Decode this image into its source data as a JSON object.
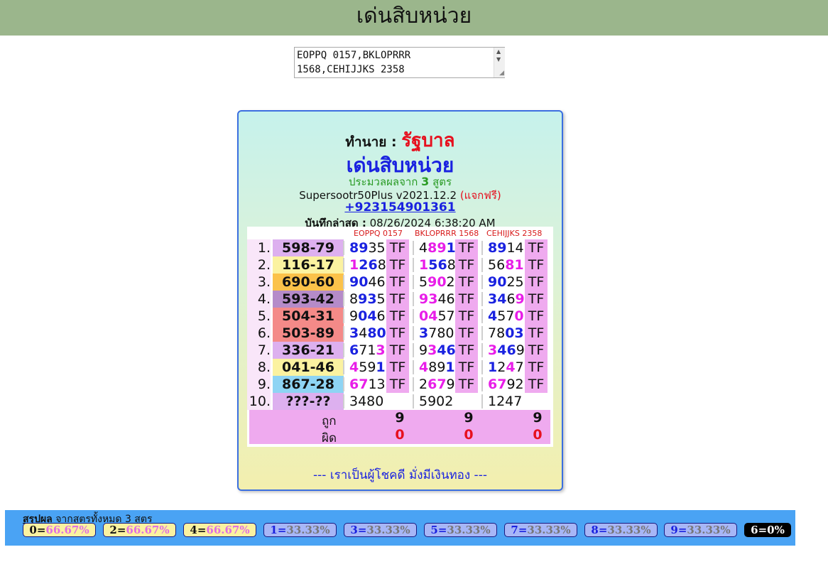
{
  "header": {
    "title": "เด่นสิบหน่วย"
  },
  "formula_input": {
    "value": "EOPPQ 0157,BKLOPRRR\n1568,CEHIJJKS 2358"
  },
  "card": {
    "by_label": "ทำนาย :",
    "by_value": "รัฐบาล",
    "title": "เด่นสิบหน่วย",
    "process_prefix": "ประมวลผลจาก",
    "process_count": "3",
    "process_suffix": "สูตร",
    "version": "Supersootr50Plus v2021.12.2",
    "free": "(แจกฟรี)",
    "phone": "+923154901361",
    "saved_label": "บันทึกล่าสุด :",
    "saved_value": "08/26/2024 6:38:20 AM",
    "motto": "--- เราเป็นผู้โชคดี มั่งมีเงินทอง ---"
  },
  "table": {
    "columns": [
      "EOPPQ 0157",
      "BKLOPRRR 1568",
      "CEHIJJKS 2358"
    ],
    "rows": [
      {
        "no": "1.",
        "pred": "598-79",
        "color": "#ddb0ef",
        "res": [
          [
            [
              "89",
              "b"
            ],
            [
              "35",
              "n"
            ]
          ],
          [
            [
              "4",
              "n"
            ],
            [
              "89",
              "m"
            ],
            [
              "1",
              "b"
            ]
          ],
          [
            [
              "89",
              "b"
            ],
            [
              "14",
              "n"
            ]
          ]
        ],
        "tf": [
          "TF",
          "TF",
          "TF"
        ]
      },
      {
        "no": "2.",
        "pred": "116-17",
        "color": "#fbf2a0",
        "res": [
          [
            [
              "1",
              "m"
            ],
            [
              "26",
              "b"
            ],
            [
              "8",
              "n"
            ]
          ],
          [
            [
              "1",
              "m"
            ],
            [
              "56",
              "b"
            ],
            [
              "8",
              "n"
            ]
          ],
          [
            [
              "56",
              "n"
            ],
            [
              "81",
              "m"
            ]
          ]
        ],
        "tf": [
          "TF",
          "TF",
          "TF"
        ]
      },
      {
        "no": "3.",
        "pred": "690-60",
        "color": "#fbc24a",
        "res": [
          [
            [
              "90",
              "b"
            ],
            [
              "46",
              "n"
            ]
          ],
          [
            [
              "5",
              "n"
            ],
            [
              "90",
              "m"
            ],
            [
              "2",
              "n"
            ]
          ],
          [
            [
              "90",
              "b"
            ],
            [
              "25",
              "n"
            ]
          ]
        ],
        "tf": [
          "TF",
          "TF",
          "TF"
        ]
      },
      {
        "no": "4.",
        "pred": "593-42",
        "color": "#b58bc9",
        "res": [
          [
            [
              "8",
              "n"
            ],
            [
              "93",
              "b"
            ],
            [
              "5",
              "n"
            ]
          ],
          [
            [
              "93",
              "m"
            ],
            [
              "46",
              "n"
            ]
          ],
          [
            [
              "34",
              "b"
            ],
            [
              "6",
              "n"
            ],
            [
              "9",
              "m"
            ]
          ]
        ],
        "tf": [
          "TF",
          "TF",
          "TF"
        ]
      },
      {
        "no": "5.",
        "pred": "504-31",
        "color": "#f48a88",
        "res": [
          [
            [
              "9",
              "n"
            ],
            [
              "04",
              "b"
            ],
            [
              "6",
              "n"
            ]
          ],
          [
            [
              "04",
              "m"
            ],
            [
              "57",
              "n"
            ]
          ],
          [
            [
              "4",
              "b"
            ],
            [
              "57",
              "n"
            ],
            [
              "0",
              "m"
            ]
          ]
        ],
        "tf": [
          "TF",
          "TF",
          "TF"
        ]
      },
      {
        "no": "6.",
        "pred": "503-89",
        "color": "#f48a88",
        "res": [
          [
            [
              "3",
              "b"
            ],
            [
              "4",
              "n"
            ],
            [
              "80",
              "b"
            ]
          ],
          [
            [
              "3",
              "b"
            ],
            [
              "780",
              "n"
            ]
          ],
          [
            [
              "78",
              "n"
            ],
            [
              "03",
              "b"
            ]
          ]
        ],
        "tf": [
          "TF",
          "TF",
          "TF"
        ]
      },
      {
        "no": "7.",
        "pred": "336-21",
        "color": "#ddb0ef",
        "res": [
          [
            [
              "6",
              "b"
            ],
            [
              "71",
              "n"
            ],
            [
              "3",
              "m"
            ]
          ],
          [
            [
              "9",
              "n"
            ],
            [
              "3",
              "m"
            ],
            [
              "46",
              "b"
            ]
          ],
          [
            [
              "3",
              "m"
            ],
            [
              "46",
              "b"
            ],
            [
              "9",
              "n"
            ]
          ]
        ],
        "tf": [
          "TF",
          "TF",
          "TF"
        ]
      },
      {
        "no": "8.",
        "pred": "041-46",
        "color": "#fbf2a0",
        "res": [
          [
            [
              "4",
              "m"
            ],
            [
              "59",
              "n"
            ],
            [
              "1",
              "b"
            ]
          ],
          [
            [
              "4",
              "m"
            ],
            [
              "89",
              "n"
            ],
            [
              "1",
              "b"
            ]
          ],
          [
            [
              "1",
              "b"
            ],
            [
              "2",
              "n"
            ],
            [
              "4",
              "m"
            ],
            [
              "7",
              "n"
            ]
          ]
        ],
        "tf": [
          "TF",
          "TF",
          "TF"
        ]
      },
      {
        "no": "9.",
        "pred": "867-28",
        "color": "#8ed4f4",
        "res": [
          [
            [
              "67",
              "m"
            ],
            [
              "13",
              "n"
            ]
          ],
          [
            [
              "2",
              "n"
            ],
            [
              "67",
              "m"
            ],
            [
              "9",
              "n"
            ]
          ],
          [
            [
              "67",
              "m"
            ],
            [
              "92",
              "n"
            ]
          ]
        ],
        "tf": [
          "TF",
          "TF",
          "TF"
        ]
      },
      {
        "no": "10.",
        "pred": "???-??",
        "color": "#ddb0ef",
        "res": [
          [
            [
              "3480",
              "n"
            ]
          ],
          [
            [
              "5902",
              "n"
            ]
          ],
          [
            [
              "1247",
              "n"
            ]
          ]
        ],
        "tf": [
          "",
          "",
          ""
        ]
      }
    ],
    "correct_label": "ถูก",
    "wrong_label": "ผิด",
    "correct": [
      "9",
      "9",
      "9"
    ],
    "wrong": [
      "0",
      "0",
      "0"
    ]
  },
  "summary": {
    "label": "สรุปผล",
    "suffix": "จากสูตรทั้งหมด 3 สูตร",
    "chips": [
      {
        "digit": "0",
        "pct": "66.67%",
        "kind": "hot"
      },
      {
        "digit": "2",
        "pct": "66.67%",
        "kind": "hot"
      },
      {
        "digit": "4",
        "pct": "66.67%",
        "kind": "hot"
      },
      {
        "digit": "1",
        "pct": "33.33%",
        "kind": "mid"
      },
      {
        "digit": "3",
        "pct": "33.33%",
        "kind": "mid"
      },
      {
        "digit": "5",
        "pct": "33.33%",
        "kind": "mid"
      },
      {
        "digit": "7",
        "pct": "33.33%",
        "kind": "mid"
      },
      {
        "digit": "8",
        "pct": "33.33%",
        "kind": "mid"
      },
      {
        "digit": "9",
        "pct": "33.33%",
        "kind": "mid"
      },
      {
        "digit": "6",
        "pct": "0%",
        "kind": "dead"
      }
    ]
  },
  "colors": {
    "header_bg": "#9bb68c",
    "accent_blue": "#1a22e0",
    "accent_red": "#e6101e",
    "pink": "#efaaef",
    "summary_bg": "#4aa3f4"
  }
}
